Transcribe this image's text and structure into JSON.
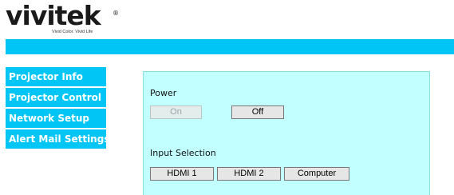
{
  "brand": {
    "logo_text": "vivitek",
    "registered_mark": "®",
    "tagline": "Vivid Color. Vivid Life"
  },
  "colors": {
    "accent": "#00c5f5",
    "panel_bg": "#c2ffff",
    "button_bg": "#e6e6e6"
  },
  "nav": {
    "items": [
      {
        "label": "Projector Info"
      },
      {
        "label": "Projector Control"
      },
      {
        "label": "Network Setup"
      },
      {
        "label": "Alert Mail Settings"
      }
    ]
  },
  "panel": {
    "power": {
      "label": "Power",
      "on_label": "On",
      "off_label": "Off"
    },
    "input": {
      "label": "Input Selection",
      "buttons": [
        "HDMI 1",
        "HDMI 2",
        "Computer"
      ]
    }
  }
}
